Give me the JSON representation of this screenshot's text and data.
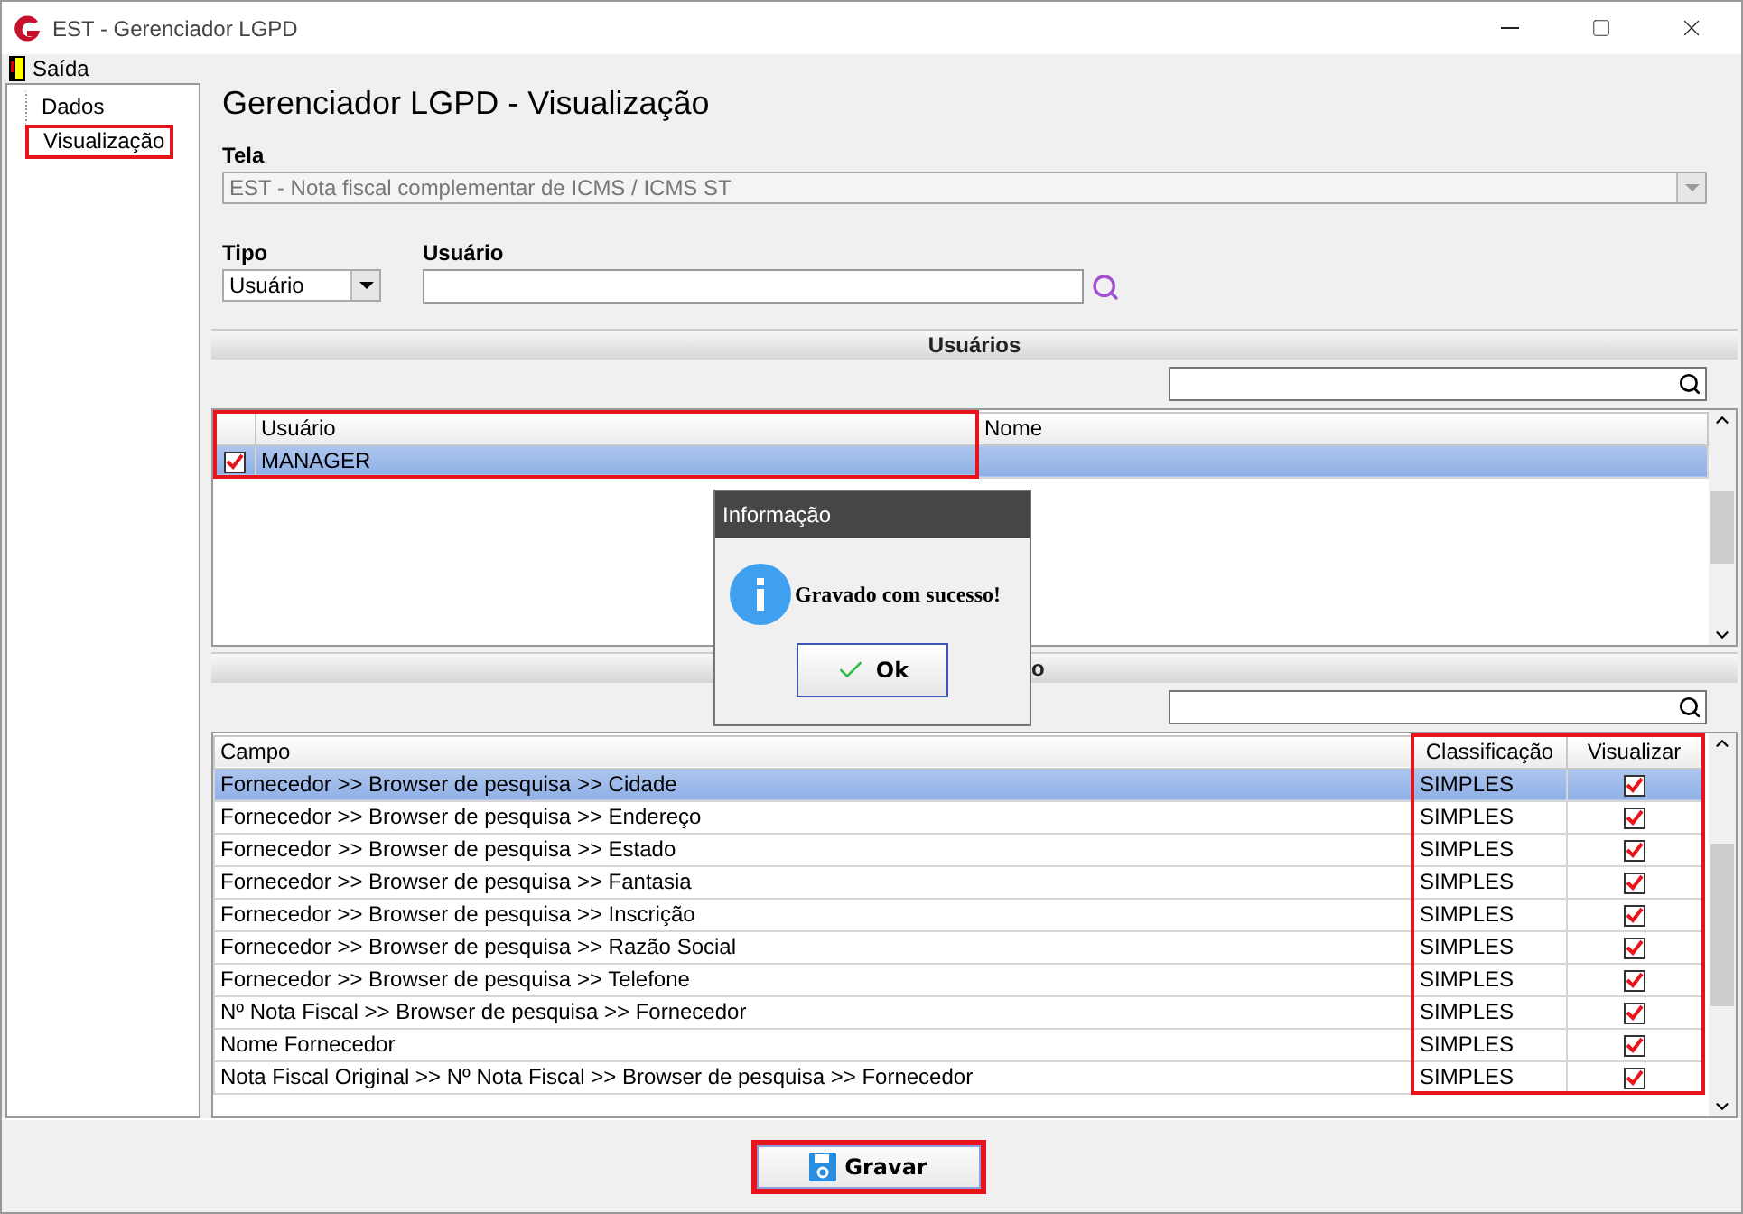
{
  "window": {
    "title": "EST - Gerenciador LGPD"
  },
  "menu": [
    {
      "label": "Saída"
    }
  ],
  "sidebar": {
    "items": [
      {
        "label": "Dados",
        "highlighted": false
      },
      {
        "label": "Visualização",
        "highlighted": true
      }
    ]
  },
  "heading": "Gerenciador LGPD - Visualização",
  "tela": {
    "label": "Tela",
    "value": "EST - Nota fiscal complementar de ICMS / ICMS ST",
    "disabled": true
  },
  "tipo": {
    "label": "Tipo",
    "value": "Usuário"
  },
  "usuario": {
    "label": "Usuário"
  },
  "users_section": {
    "title": "Usuários",
    "columns": [
      {
        "label": "Usuário",
        "highlighted": true
      },
      {
        "label": "Nome",
        "highlighted": false
      }
    ],
    "rows": [
      {
        "checked": true,
        "selected": true,
        "usuario": "MANAGER"
      }
    ]
  },
  "fields_section": {
    "title_visible": "o",
    "columns": [
      {
        "label": "Campo",
        "highlighted": false
      },
      {
        "label": "Classificação",
        "highlighted": true
      },
      {
        "label": "Visualizar",
        "highlighted": true
      }
    ],
    "rows": [
      {
        "campo": "Fornecedor >> Browser de pesquisa >> Cidade",
        "classificacao": "SIMPLES",
        "visualizar": true,
        "selected": true
      },
      {
        "campo": "Fornecedor >> Browser de pesquisa >> Endereço",
        "classificacao": "SIMPLES",
        "visualizar": true,
        "selected": false
      },
      {
        "campo": "Fornecedor >> Browser de pesquisa >> Estado",
        "classificacao": "SIMPLES",
        "visualizar": true,
        "selected": false
      },
      {
        "campo": "Fornecedor >> Browser de pesquisa >> Fantasia",
        "classificacao": "SIMPLES",
        "visualizar": true,
        "selected": false
      },
      {
        "campo": "Fornecedor >> Browser de pesquisa >> Inscrição",
        "classificacao": "SIMPLES",
        "visualizar": true,
        "selected": false
      },
      {
        "campo": "Fornecedor >> Browser de pesquisa >> Razão Social",
        "classificacao": "SIMPLES",
        "visualizar": true,
        "selected": false
      },
      {
        "campo": "Fornecedor >> Browser de pesquisa >> Telefone",
        "classificacao": "SIMPLES",
        "visualizar": true,
        "selected": false
      },
      {
        "campo": "Nº Nota Fiscal >> Browser de pesquisa >> Fornecedor",
        "classificacao": "SIMPLES",
        "visualizar": true,
        "selected": false
      },
      {
        "campo": "Nome Fornecedor",
        "classificacao": "SIMPLES",
        "visualizar": true,
        "selected": false
      },
      {
        "campo": "Nota Fiscal Original >> Nº Nota Fiscal >> Browser de pesquisa >> Fornecedor",
        "classificacao": "SIMPLES",
        "visualizar": true,
        "selected": false
      }
    ]
  },
  "dialog": {
    "title": "Informação",
    "message": "Gravado com sucesso!",
    "button": "Ok"
  },
  "save_button": {
    "label": "Gravar",
    "highlighted": true
  }
}
